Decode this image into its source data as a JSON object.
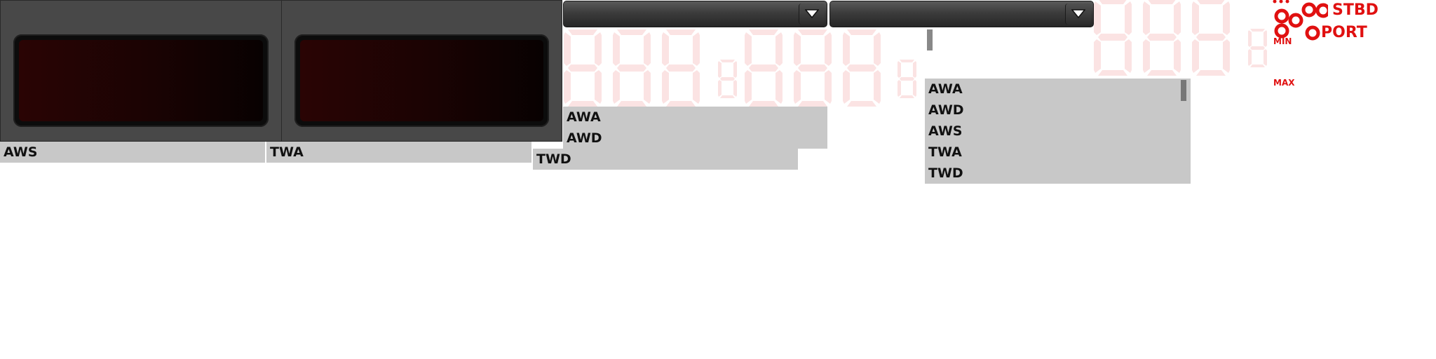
{
  "panels": [
    {
      "name": "display-aws"
    },
    {
      "name": "display-twa"
    }
  ],
  "labels": {
    "aws": "AWS",
    "twa": "TWA",
    "twd": "TWD"
  },
  "dropdown_list_a": {
    "items": [
      "AWA",
      "AWD"
    ]
  },
  "dropdown_list_b": {
    "items": [
      "AWA",
      "AWD",
      "AWS",
      "TWA",
      "TWD"
    ]
  },
  "segment_display": {
    "placeholder_digit": "8"
  },
  "indicators": {
    "stbd": "STBD",
    "port": "PORT",
    "min": "MIN",
    "max": "MAX"
  },
  "colors": {
    "panel": "#484848",
    "screen_glow": "#2a0404",
    "label_bg": "#c8c8c8",
    "segment_off": "#fbe3e3",
    "indicator_red": "#e01010"
  },
  "icons": [
    "chevron-down-icon",
    "led-ring-icon"
  ]
}
